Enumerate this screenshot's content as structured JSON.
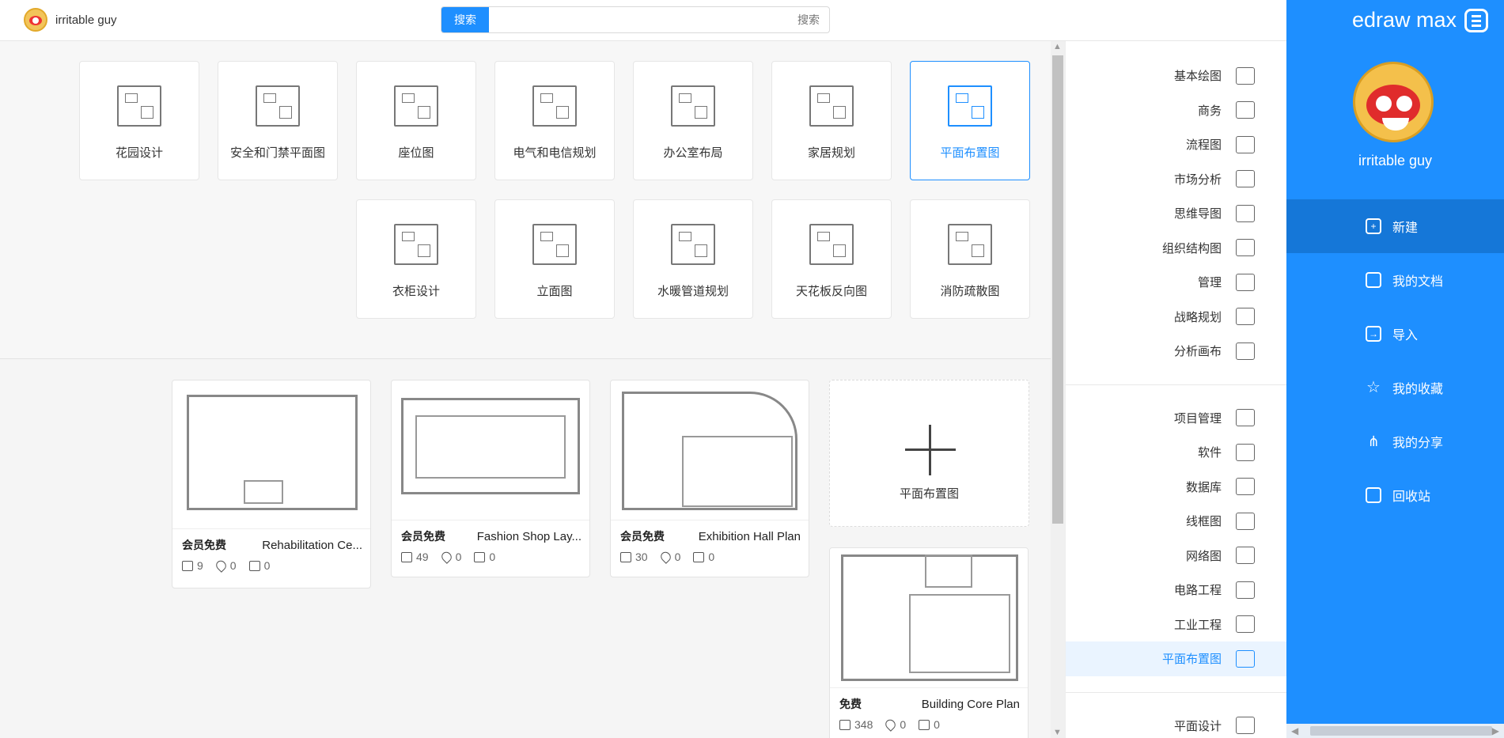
{
  "header": {
    "user_name": "irritable guy",
    "search_button": "搜索",
    "search_placeholder": "搜索"
  },
  "sidebar": {
    "logo_text": "edraw max",
    "user_name": "irritable guy",
    "items": [
      {
        "label": "新建",
        "icon": "new-file-icon",
        "active": true
      },
      {
        "label": "我的文档",
        "icon": "document-icon",
        "active": false
      },
      {
        "label": "导入",
        "icon": "import-icon",
        "active": false
      },
      {
        "label": "我的收藏",
        "icon": "star-icon",
        "active": false
      },
      {
        "label": "我的分享",
        "icon": "share-icon",
        "active": false
      },
      {
        "label": "回收站",
        "icon": "trash-icon",
        "active": false
      }
    ]
  },
  "categories": {
    "group1": [
      "基本绘图",
      "商务",
      "流程图",
      "市场分析",
      "思维导图",
      "组织结构图",
      "管理",
      "战略规划",
      "分析画布"
    ],
    "group2": [
      "项目管理",
      "软件",
      "数据库",
      "线框图",
      "网络图",
      "电路工程",
      "工业工程",
      "平面布置图"
    ],
    "group3": [
      "平面设计"
    ],
    "active": "平面布置图"
  },
  "templates": {
    "row1": [
      "平面布置图",
      "家居规划",
      "办公室布局",
      "电气和电信规划",
      "座位图",
      "安全和门禁平面图",
      "花园设计"
    ],
    "row2": [
      "消防疏散图",
      "天花板反向图",
      "水暖管道规划",
      "立面图",
      "衣柜设计"
    ],
    "selected": "平面布置图"
  },
  "new_card": {
    "label": "平面布置图"
  },
  "docs": [
    {
      "title": "Building Core Plan",
      "badge": "免费",
      "likes": "0",
      "favs": "0",
      "copies": "348"
    },
    {
      "title": "Exhibition Hall Plan",
      "badge": "会员免费",
      "likes": "0",
      "favs": "0",
      "copies": "30"
    },
    {
      "title": "Fashion Shop Lay...",
      "badge": "会员免费",
      "likes": "0",
      "favs": "0",
      "copies": "49"
    },
    {
      "title": "Rehabilitation Ce...",
      "badge": "会员免费",
      "likes": "0",
      "favs": "0",
      "copies": "9"
    }
  ],
  "colors": {
    "accent": "#1e8fff",
    "sidebar_active": "#1577d8"
  }
}
